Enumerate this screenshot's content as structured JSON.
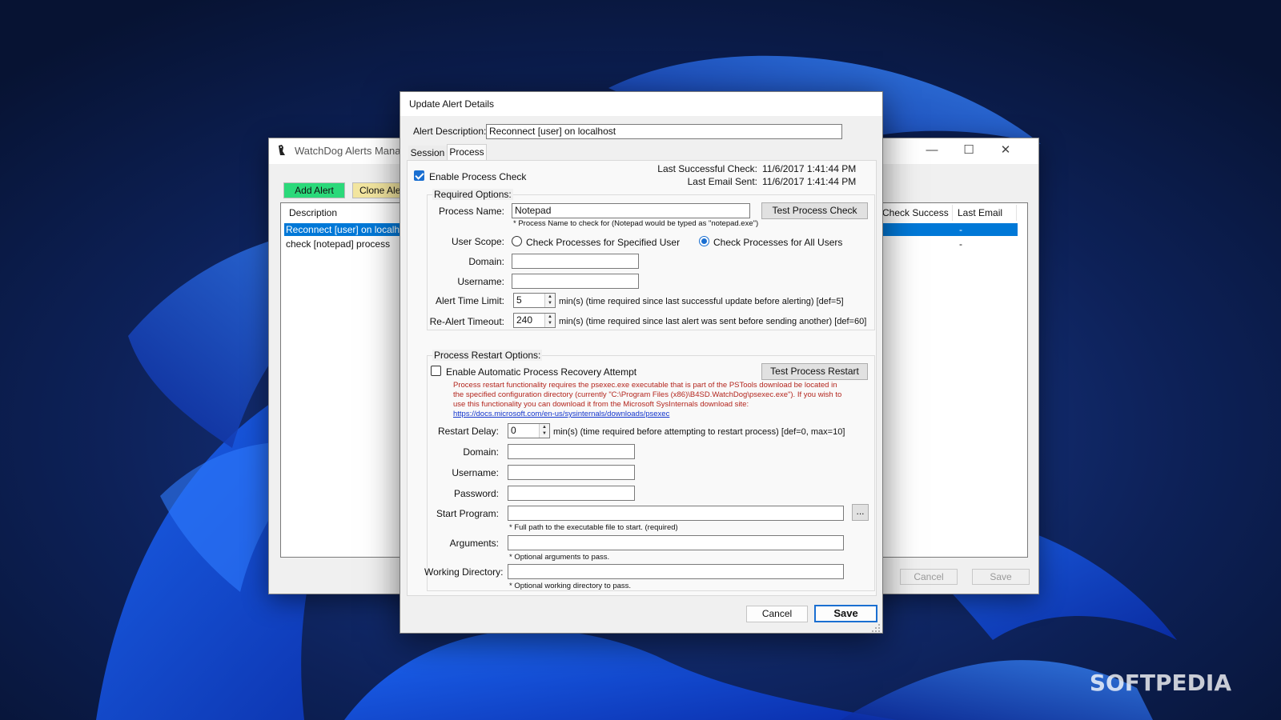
{
  "main_window": {
    "title": "WatchDog Alerts Manag",
    "add_alert_label": "Add Alert",
    "clone_alert_label": "Clone Ale",
    "columns": [
      "Description",
      "Check Success",
      "Last Email"
    ],
    "rows": [
      {
        "description": "Reconnect [user] on localhost",
        "last_email": "-",
        "selected": true
      },
      {
        "description": "check [notepad] process",
        "last_email": "-",
        "selected": false
      }
    ],
    "cancel_label": "Cancel",
    "save_label": "Save",
    "window_controls": {
      "minimize": "—",
      "maximize": "☐",
      "close": "✕"
    }
  },
  "dialog": {
    "title": "Update Alert Details",
    "alert_description_label": "Alert Description:",
    "alert_description_value": "Reconnect [user] on localhost",
    "tabs": [
      {
        "label": "Session",
        "active": false
      },
      {
        "label": "Process",
        "active": true
      }
    ],
    "enable_process_check_label": "Enable Process Check",
    "enable_process_check_checked": true,
    "last_successful_check_label": "Last Successful Check:",
    "last_successful_check_value": "11/6/2017 1:41:44 PM",
    "last_email_sent_label": "Last Email Sent:",
    "last_email_sent_value": "11/6/2017 1:41:44 PM",
    "required_options": {
      "title": "Required Options:",
      "process_name_label": "Process Name:",
      "process_name_value": "Notepad",
      "process_name_hint": "* Process Name to check for (Notepad would be typed as \"notepad.exe\")",
      "test_process_check_label": "Test Process Check",
      "user_scope_label": "User Scope:",
      "scope_specified_label": "Check Processes for Specified User",
      "scope_all_label": "Check Processes for All Users",
      "domain_label": "Domain:",
      "domain_value": "",
      "username_label": "Username:",
      "username_value": "",
      "alert_time_limit_label": "Alert Time Limit:",
      "alert_time_limit_value": "5",
      "alert_time_limit_desc": "min(s)  (time required since last successful update before alerting)  [def=5]",
      "realert_timeout_label": "Re-Alert Timeout:",
      "realert_timeout_value": "240",
      "realert_timeout_desc": "min(s)  (time required since last alert was sent before sending another)  [def=60]"
    },
    "restart_options": {
      "title": "Process Restart Options:",
      "enable_recovery_label": "Enable Automatic Process Recovery Attempt",
      "enable_recovery_checked": false,
      "test_process_restart_label": "Test Process Restart",
      "warning_text": "Process restart functionality requires the psexec.exe executable that is part of the PSTools download be located in the specified configuration directory (currently \"C:\\Program Files (x86)\\B4SD.WatchDog\\psexec.exe\").  If you wish to use this functionality you can download it from the Microsoft SysInternals download site:",
      "warning_link": "https://docs.microsoft.com/en-us/sysinternals/downloads/psexec",
      "restart_delay_label": "Restart Delay:",
      "restart_delay_value": "0",
      "restart_delay_desc": "min(s)  (time required before attempting to restart process)  [def=0, max=10]",
      "domain_label": "Domain:",
      "username_label": "Username:",
      "password_label": "Password:",
      "start_program_label": "Start Program:",
      "start_program_hint": "* Full path to the executable file to start. (required)",
      "browse_label": "...",
      "arguments_label": "Arguments:",
      "arguments_hint": "* Optional arguments to pass.",
      "working_directory_label": "Working Directory:",
      "working_directory_hint": "* Optional working directory to pass."
    },
    "cancel_label": "Cancel",
    "save_label": "Save"
  },
  "watermark": "SOFTPEDIA",
  "colors": {
    "add_alert_bg": "#2bd97a",
    "clone_alert_bg": "#f3e6a0",
    "selection": "#0078d7",
    "accent": "#1a6fd1",
    "warning_text": "#b3261e"
  }
}
